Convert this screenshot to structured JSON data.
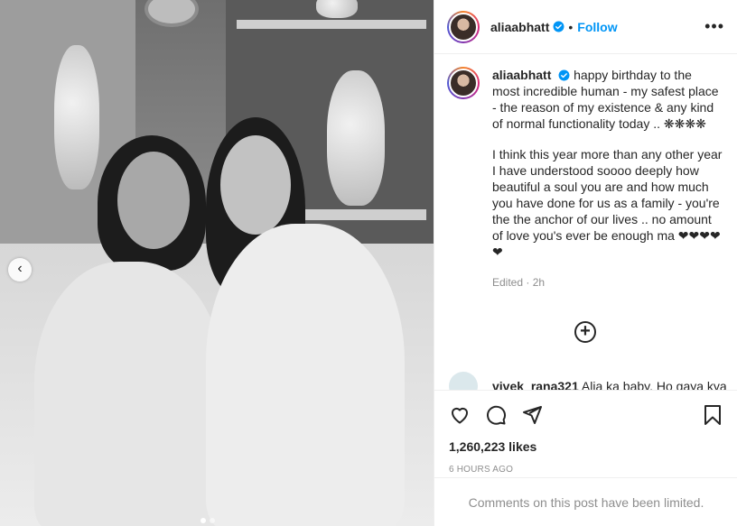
{
  "post": {
    "username": "aliaabhatt",
    "follow_label": "Follow",
    "separator": "•",
    "more_label": "•••",
    "caption_lines": [
      "happy birthday to the most incredible human - my safest place - the reason of my existence & any kind of normal functionality today .. ❋❋❋❋",
      "I think this year more than any other year I have understood soooo deeply how beautiful a soul you are and how much you have done for us as a family - you're the the anchor of our lives .. no amount of love you's ever be enough ma ❤❤❤❤❤"
    ],
    "edited_label": "Edited",
    "edited_time": "2h",
    "load_more": "+",
    "peek_comment": {
      "user": "vivek_rana321",
      "text": "Alia ka baby. Ho gaya kya"
    },
    "likes": "1,260,223 likes",
    "timestamp": "6 HOURS AGO",
    "limited_notice": "Comments on this post have been limited."
  },
  "carousel": {
    "prev_label": "‹",
    "total_dots": 2,
    "active_dot": 1
  },
  "colors": {
    "accent": "#0095f6",
    "secondary_text": "#8e8e8e",
    "border": "#efefef"
  },
  "icons": [
    "heart-icon",
    "comment-icon",
    "share-icon",
    "bookmark-icon",
    "verified-icon",
    "add-circle-icon"
  ]
}
